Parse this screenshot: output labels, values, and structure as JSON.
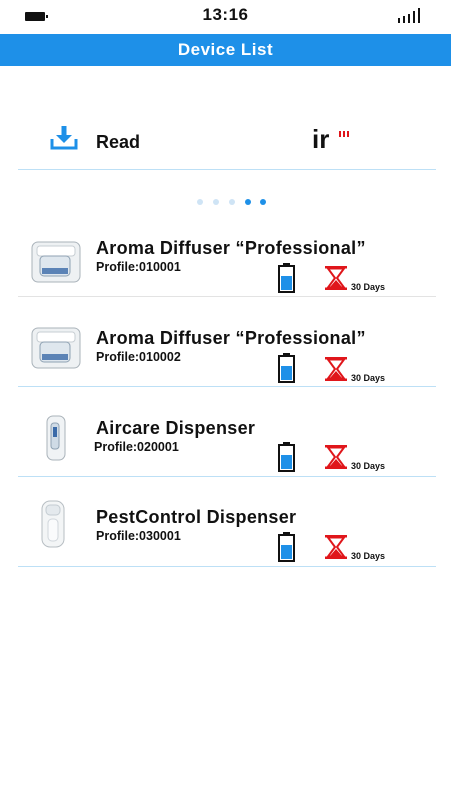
{
  "status_bar": {
    "time": "13:16"
  },
  "header": {
    "title": "Device List"
  },
  "read": {
    "label": "Read",
    "logo_text": "ir"
  },
  "pager": {
    "count": 5,
    "active": [
      3,
      4
    ]
  },
  "devices": [
    {
      "name": "Aroma Diffuser “Professional”",
      "profile": "Profile:010001",
      "days": "30 Days",
      "image": "aroma-diffuser"
    },
    {
      "name": "Aroma Diffuser “Professional”",
      "profile": "Profile:010002",
      "days": "30 Days",
      "image": "aroma-diffuser"
    },
    {
      "name": "Aircare Dispenser",
      "profile": "Profile:020001",
      "days": "30 Days",
      "image": "aircare-dispenser"
    },
    {
      "name": "PestControl Dispenser",
      "profile": "Profile:030001",
      "days": "30 Days",
      "image": "pestcontrol-dispenser"
    }
  ],
  "colors": {
    "accent": "#1E90E8",
    "timer": "#E0161B",
    "divider": "#BDE0F6"
  }
}
